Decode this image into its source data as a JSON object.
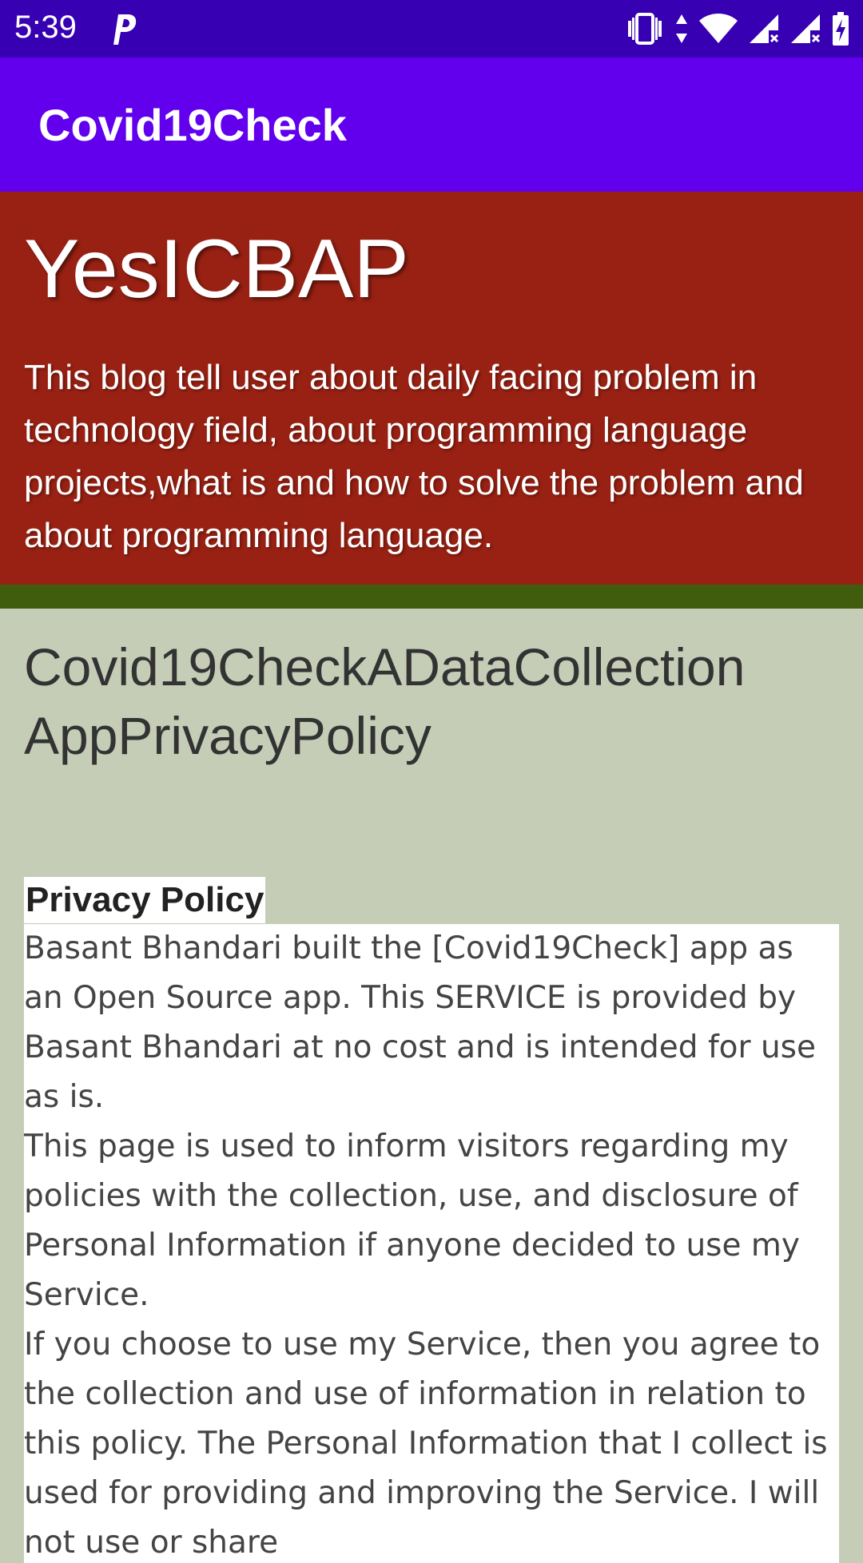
{
  "status_bar": {
    "time": "5:39",
    "icons": [
      "parking-icon",
      "vibrate-icon",
      "data-arrows-icon",
      "wifi-icon",
      "signal-no-data-icon",
      "signal-no-data-icon",
      "battery-charging-icon"
    ]
  },
  "app_bar": {
    "title": "Covid19Check"
  },
  "blog": {
    "title": "YesICBAP",
    "description": "This blog tell user about daily facing problem in technology field, about programming language projects,what is and how to solve the problem and about programming language."
  },
  "post": {
    "title": "Covid19CheckADataCollection AppPrivacyPolicy",
    "heading": "Privacy Policy",
    "paragraphs": [
      "Basant Bhandari built the [Covid19Check] app as an Open Source app. This SERVICE is provided by Basant Bhandari at no cost and is intended for use as is.",
      "This page is used to inform visitors regarding my policies with the collection, use, and disclosure of Personal Information if anyone decided to use my Service.",
      "If you choose to use my Service, then you agree to the collection and use of information in relation to this policy. The Personal Information that I collect is used for providing and improving the Service. I will not use or share"
    ]
  },
  "colors": {
    "status_bar": "#3700b3",
    "app_bar": "#6200ee",
    "blog_header": "#992113",
    "divider": "#3f5d0c",
    "page_background": "#c5cdb7"
  }
}
